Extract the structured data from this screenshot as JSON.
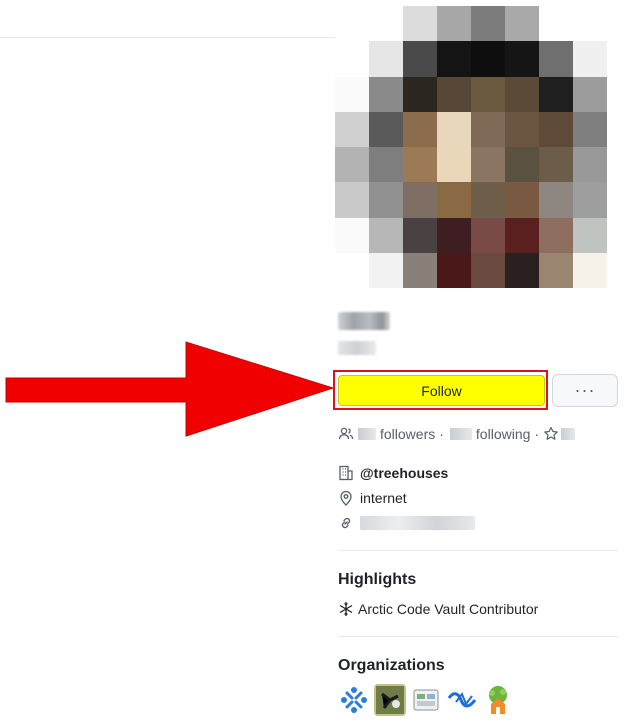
{
  "profile": {
    "follow_label": "Follow",
    "more_label": "···",
    "followers_label": "followers",
    "following_label": "following",
    "separator": "·",
    "organization": "@treehouses",
    "location": "internet"
  },
  "highlights": {
    "title": "Highlights",
    "items": [
      "Arctic Code Vault Contributor"
    ]
  },
  "organizations": {
    "title": "Organizations"
  },
  "colors": {
    "follow_bg": "#ffff00",
    "highlight_border": "#d9121e",
    "arrow": "#f00000"
  },
  "icons": [
    "people-icon",
    "star-icon",
    "building-icon",
    "location-icon",
    "link-icon",
    "snowflake-icon"
  ]
}
